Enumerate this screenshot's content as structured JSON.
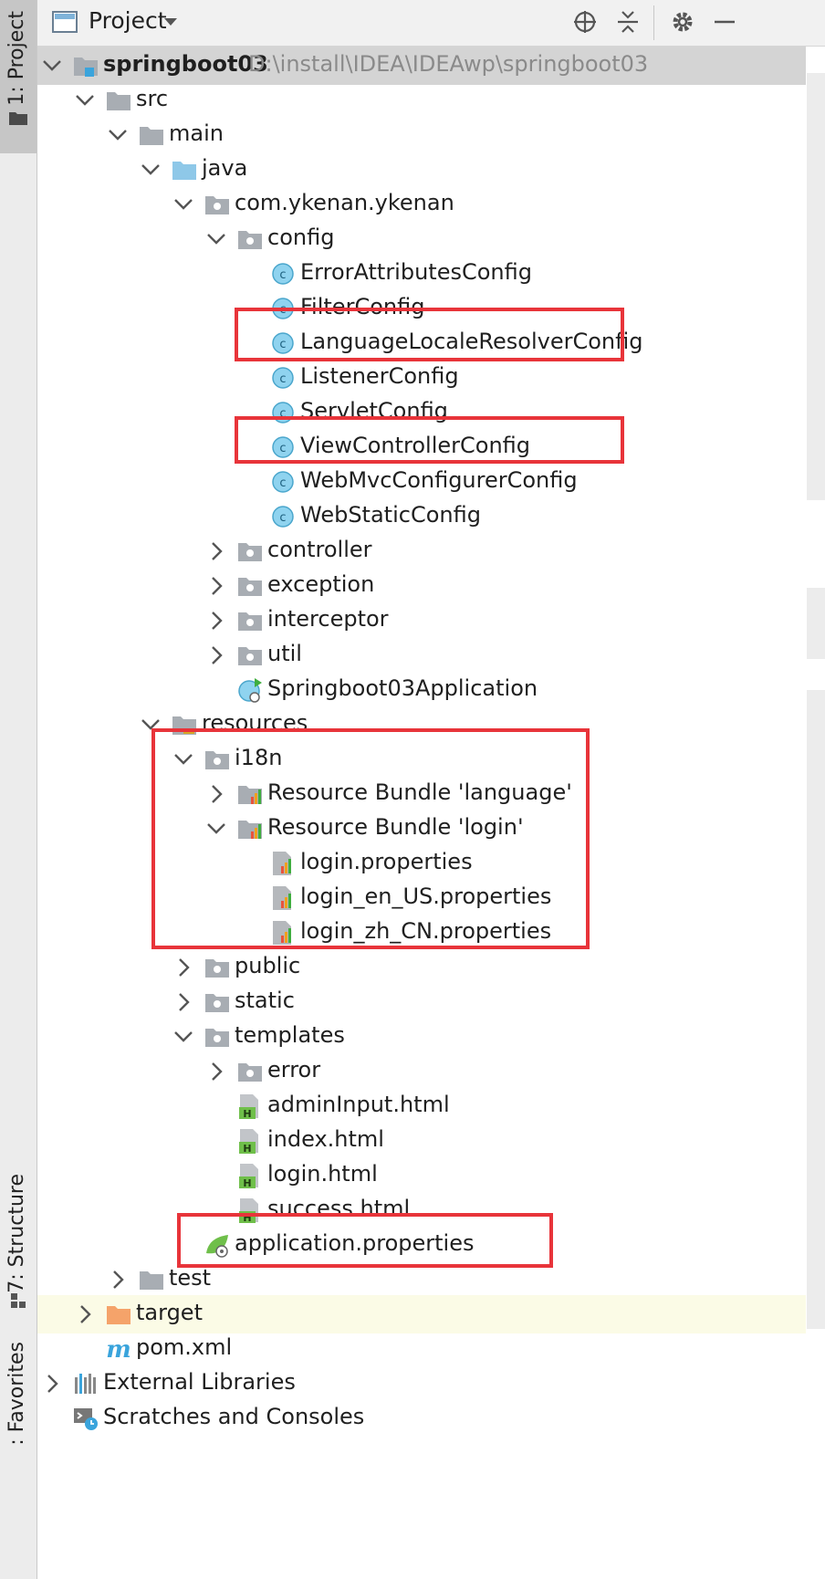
{
  "toolbar": {
    "title": "Project",
    "icons": [
      "locate-icon",
      "collapse-icon",
      "gear-icon",
      "minimize-icon"
    ]
  },
  "side_tabs": {
    "project": "1: Project",
    "structure": "7: Structure",
    "favorites": ": Favorites"
  },
  "tree": {
    "root": {
      "name": "springboot03",
      "path": "D:\\install\\IDEA\\IDEAwp\\springboot03"
    },
    "src": "src",
    "main": "main",
    "java": "java",
    "package": "com.ykenan.ykenan",
    "config": "config",
    "config_classes": [
      "ErrorAttributesConfig",
      "FilterConfig",
      "LanguageLocaleResolverConfig",
      "ListenerConfig",
      "ServletConfig",
      "ViewControllerConfig",
      "WebMvcConfigurerConfig",
      "WebStaticConfig"
    ],
    "packages": [
      "controller",
      "exception",
      "interceptor",
      "util"
    ],
    "app_class": "Springboot03Application",
    "resources": "resources",
    "i18n": "i18n",
    "bundle_language": "Resource Bundle 'language'",
    "bundle_login": "Resource Bundle 'login'",
    "login_files": [
      "login.properties",
      "login_en_US.properties",
      "login_zh_CN.properties"
    ],
    "public": "public",
    "static": "static",
    "templates": "templates",
    "error": "error",
    "html_files": [
      "adminInput.html",
      "index.html",
      "login.html",
      "success.html"
    ],
    "app_props": "application.properties",
    "test": "test",
    "target": "target",
    "pom": "pom.xml",
    "ext_libs": "External Libraries",
    "scratches": "Scratches and Consoles"
  },
  "colors": {
    "highlight_box": "#e8343a",
    "folder_gray": "#a8adb3",
    "folder_blue": "#8ec8e8",
    "folder_orange": "#f5a36a",
    "class_icon": "#8fd3ef"
  }
}
